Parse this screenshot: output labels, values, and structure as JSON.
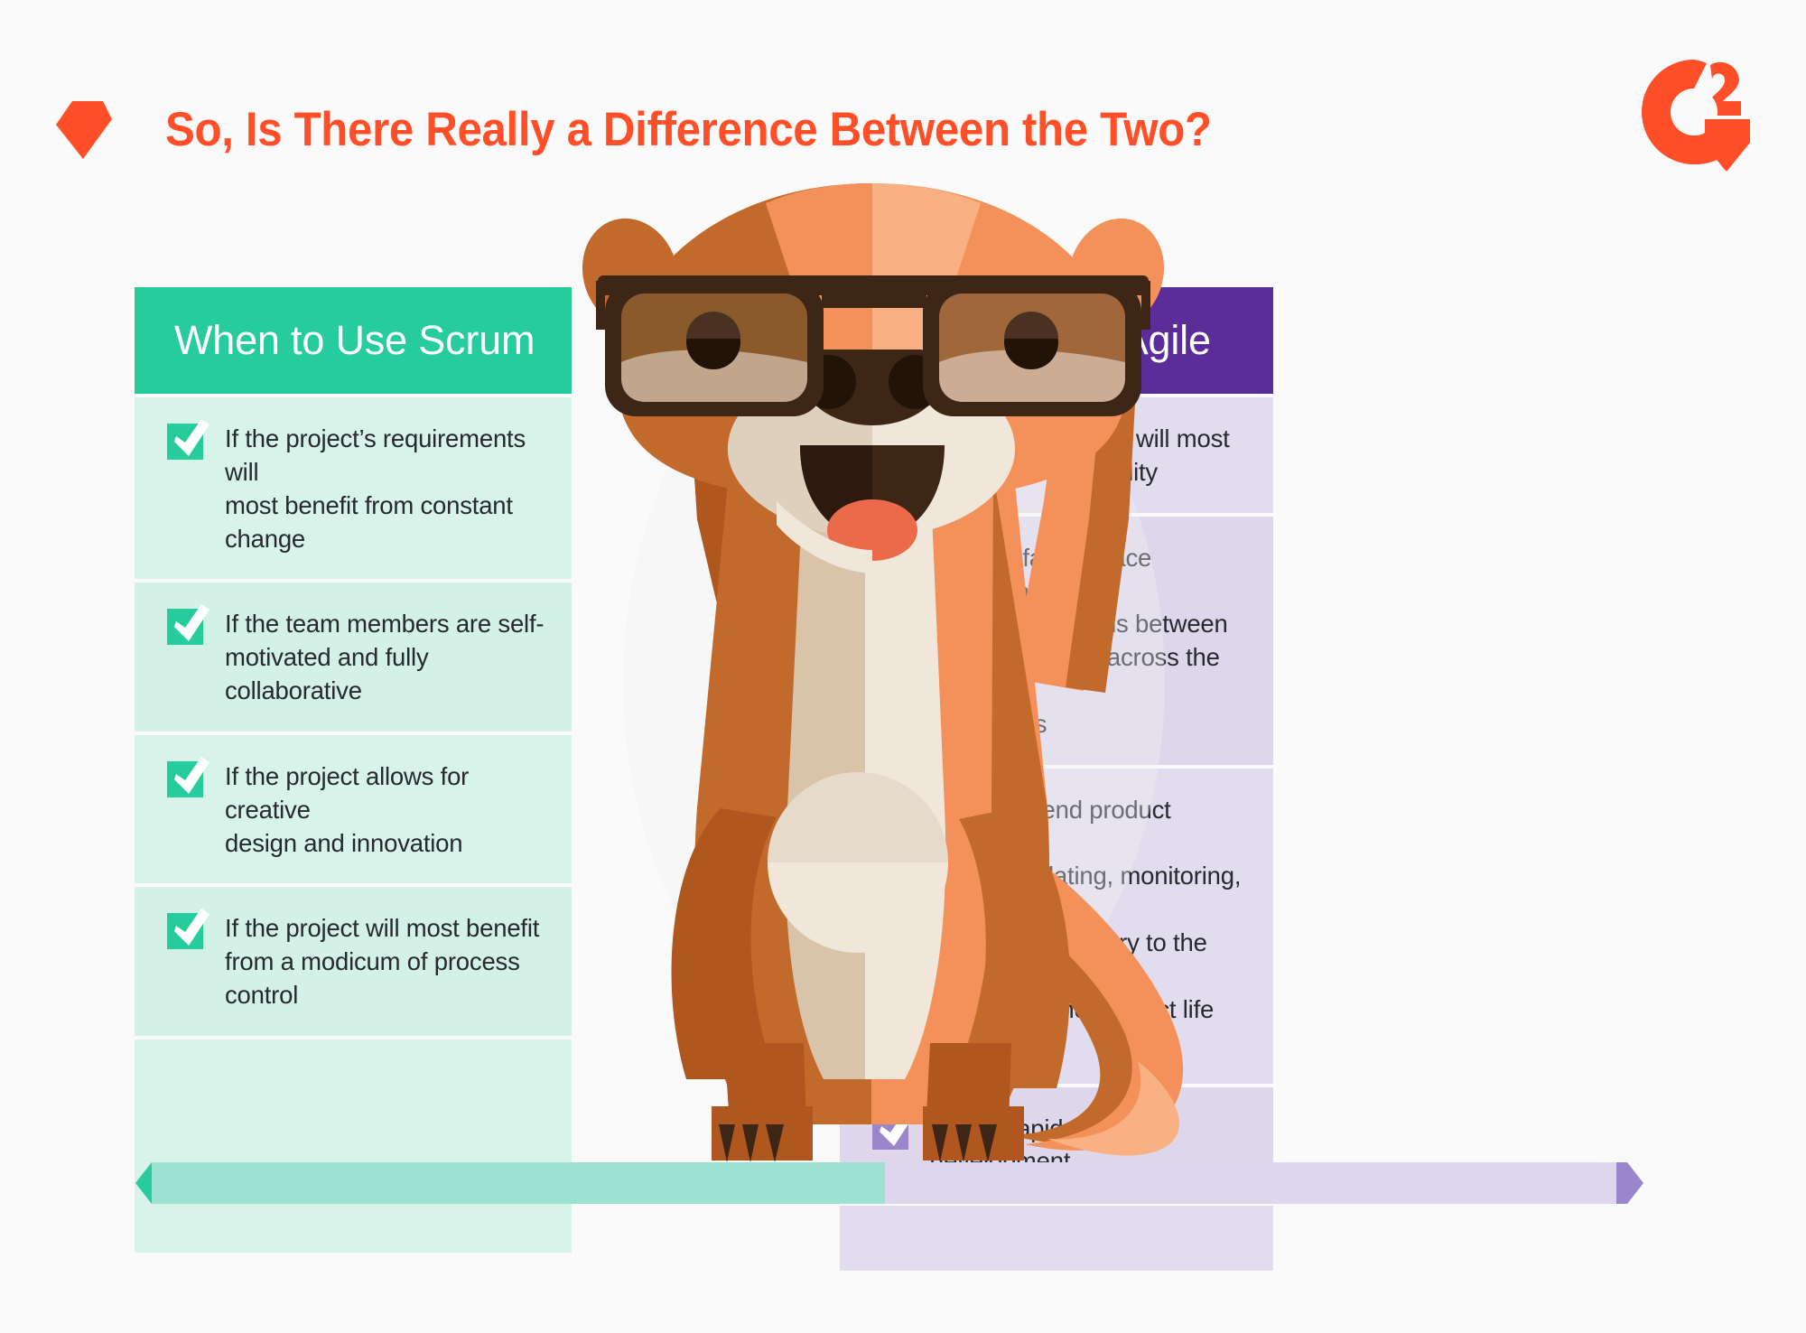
{
  "header": {
    "title": "So, Is There Really a Difference Between the Two?",
    "arrow_icon": "pennant-arrow-icon",
    "logo": "g2-logo",
    "logo_text": "G2",
    "title_color": "#ff4f29"
  },
  "mascot": {
    "name": "meerkat-mascot-with-glasses"
  },
  "panels": [
    {
      "id": "scrum",
      "heading": "When to Use Scrum",
      "header_color": "#26cc9b",
      "body_color": "#d7f3ea",
      "checkbox_color": "#26cc9b",
      "items": [
        "If the project’s requirements will\nmost benefit from constant change",
        "If the team members are self-\nmotivated and fully collaborative",
        "If the project allows for creative\ndesign and innovation",
        "If the project will most benefit\nfrom a modicum of process control"
      ]
    },
    {
      "id": "agile",
      "heading": "When to Use Agile",
      "header_color": "#5b2d9b",
      "body_color": "#e2dcef",
      "checkbox_color": "#9a87cb",
      "items": [
        "If the product itself will most\nbenefit from flexibility",
        "Regular face-to-face interactions\nand collaborations between\nteam members, across the org,\nand clients",
        "When the end product requires\nregular updating, monitoring, and\ncontinuous delivery to the client\nthroughout the product life cycle",
        "During rapid software development"
      ]
    }
  ],
  "bottom_bar": {
    "left_icon": "chevron-left-icon",
    "right_icon": "chevron-right-icon",
    "left_color": "#9be2d0",
    "left_cap_color": "#26cc9b",
    "right_color": "#ddd6ec",
    "right_cap_color": "#9a87cb"
  }
}
